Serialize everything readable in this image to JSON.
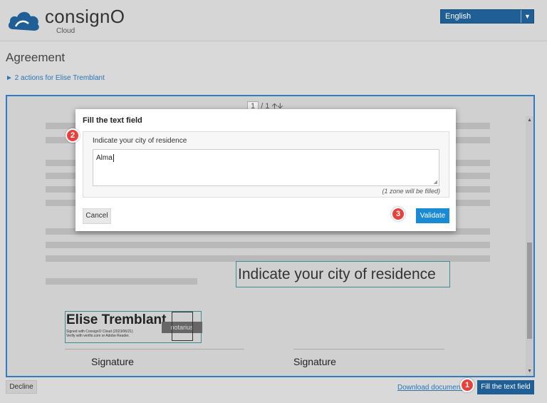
{
  "header": {
    "brand": "consignO",
    "brand_sub": "Cloud",
    "language": "English",
    "dropdown_icon": "chevron-down-icon"
  },
  "document": {
    "title": "Agreement",
    "actions_link": "► 2 actions for Elise Tremblant",
    "pager": {
      "current": "1",
      "total": "/ 1"
    },
    "zone_text": "Indicate your city of residence",
    "signature": {
      "name": "Elise Tremblant",
      "small_text_1": "Signed with ConsignO Cloud (2023/06/21)",
      "small_text_2": "Verify with verifio.com or Adobe Reader.",
      "logo_text": "notarius"
    },
    "signature_labels": [
      "Signature",
      "Signature"
    ]
  },
  "modal": {
    "title": "Fill the text field",
    "label": "Indicate your city of residence",
    "value": "Alma",
    "note": "(1 zone will be filled)",
    "cancel_label": "Cancel",
    "validate_label": "Validate"
  },
  "footer": {
    "decline_label": "Decline",
    "download_label": "Download document",
    "fill_label": "Fill the text field"
  },
  "badges": [
    "1",
    "2",
    "3"
  ],
  "colors": {
    "brand_blue": "#1f5f96",
    "accent_blue": "#1a8ad4",
    "badge_red": "#e8413c"
  }
}
